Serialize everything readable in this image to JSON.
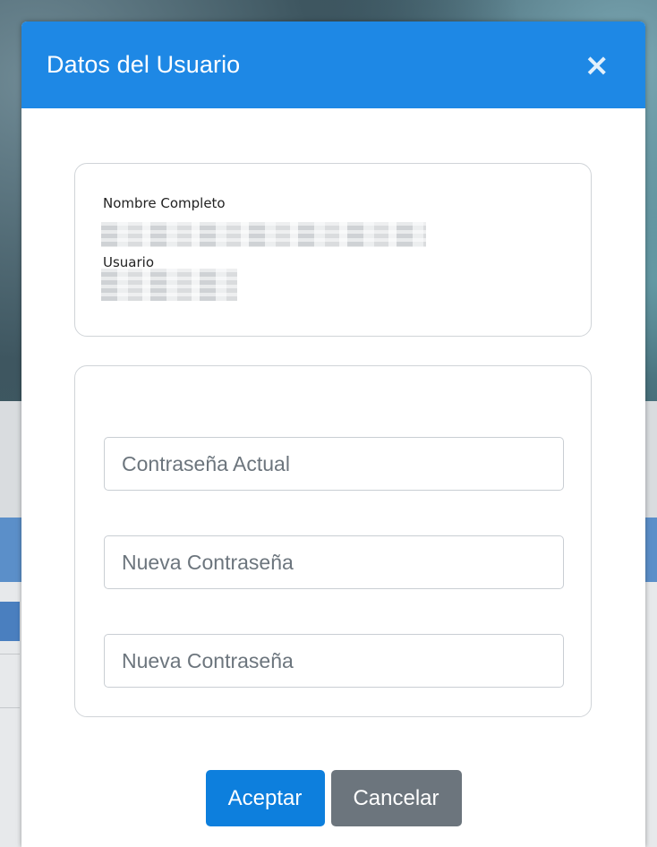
{
  "modal": {
    "title": "Datos del Usuario",
    "close_symbol": "×"
  },
  "user_info": {
    "full_name_label": "Nombre Completo",
    "username_label": "Usuario"
  },
  "password_form": {
    "current_password_placeholder": "Contraseña Actual",
    "new_password_placeholder": "Nueva Contraseña",
    "confirm_password_placeholder": "Nueva Contraseña"
  },
  "actions": {
    "accept_label": "Aceptar",
    "cancel_label": "Cancelar"
  },
  "colors": {
    "header": "#1e88e5",
    "primary_button": "#0d7fdd",
    "secondary_button": "#6c757d"
  },
  "icons": {
    "close": "close-icon"
  }
}
